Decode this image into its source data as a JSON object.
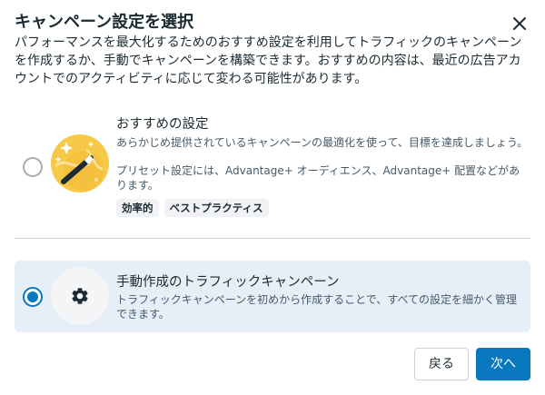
{
  "dialog": {
    "title": "キャンペーン設定を選択",
    "description": "パフォーマンスを最大化するためのおすすめ設定を利用してトラフィックのキャンペーンを作成するか、手動でキャンペーンを構築できます。おすすめの内容は、最近の広告アカウントでのアクティビティに応じて変わる可能性があります。"
  },
  "options": {
    "recommended": {
      "title": "おすすめの設定",
      "description_1": "あらかじめ提供されているキャンペーンの最適化を使って、目標を達成しましょう。",
      "description_2": "プリセット設定には、Advantage+ オーディエンス、Advantage+ 配置などがあります。",
      "tags": [
        "効率的",
        "ベストプラクティス"
      ],
      "icon": "magic-wand-icon",
      "selected": false
    },
    "manual": {
      "title": "手動作成のトラフィックキャンペーン",
      "description": "トラフィックキャンペーンを初めから作成することで、すべての設定を細かく管理できます。",
      "icon": "gear-icon",
      "selected": true
    }
  },
  "buttons": {
    "back": "戻る",
    "next": "次へ"
  },
  "colors": {
    "primary": "#0a78be",
    "selected_bg": "#e6eef7",
    "text": "#1c2b33",
    "secondary_text": "#465a69",
    "illustration_yellow": "#f7c948"
  }
}
